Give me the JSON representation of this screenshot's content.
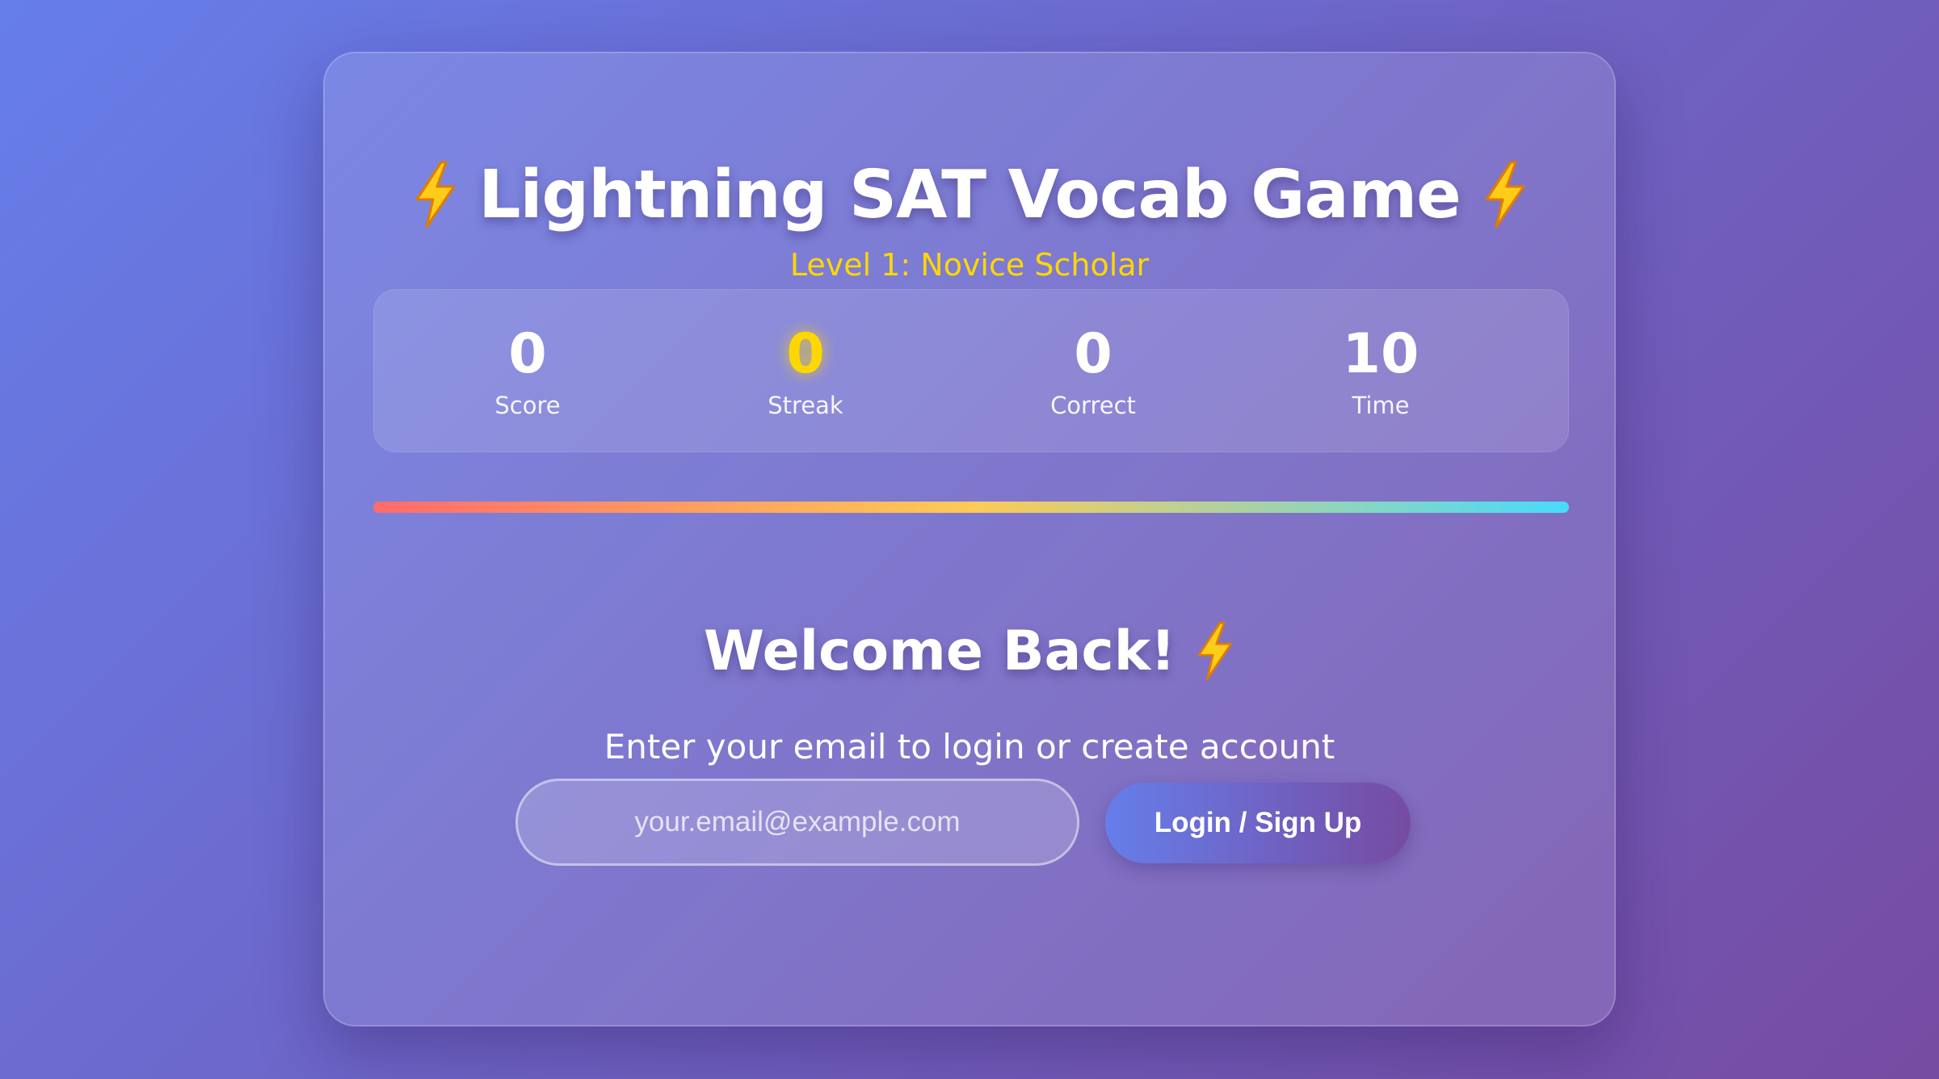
{
  "header": {
    "title": "Lightning SAT Vocab Game",
    "title_icon": "lightning-bolt-icon",
    "level": "Level 1: Novice Scholar"
  },
  "stats": {
    "score": {
      "value": "0",
      "label": "Score"
    },
    "streak": {
      "value": "0",
      "label": "Streak"
    },
    "correct": {
      "value": "0",
      "label": "Correct"
    },
    "time": {
      "value": "10",
      "label": "Time"
    }
  },
  "progress": {
    "fraction": 1.0
  },
  "login": {
    "heading": "Welcome Back!",
    "heading_icon": "lightning-bolt-icon",
    "subtitle": "Enter your email to login or create account",
    "email_value": "",
    "email_placeholder": "your.email@example.com",
    "button_label": "Login / Sign Up"
  },
  "colors": {
    "background_start": "#667eea",
    "background_end": "#764ba2",
    "accent_gold": "#ffd700",
    "progress_start": "#ff6b6b",
    "progress_mid": "#feca57",
    "progress_end": "#48dbfb"
  }
}
